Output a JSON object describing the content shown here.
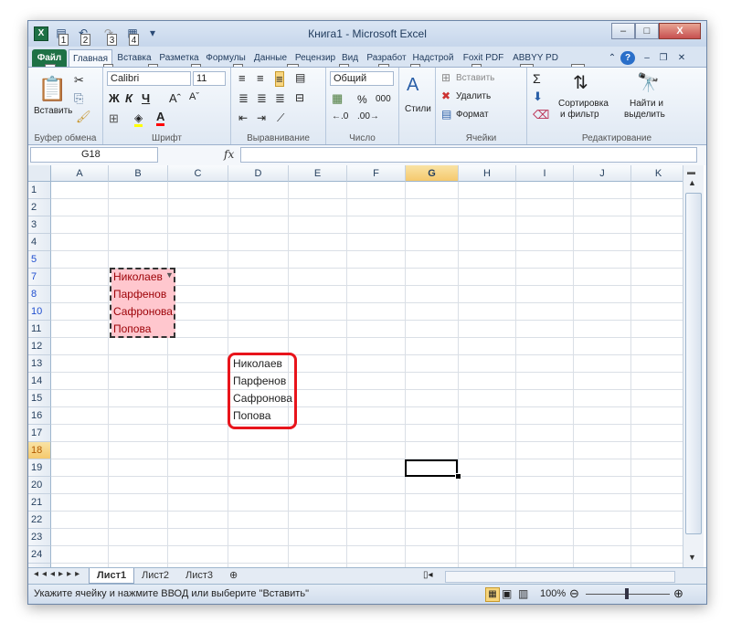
{
  "window": {
    "title": "Книга1 - Microsoft Excel",
    "minimize": "–",
    "maximize": "□",
    "close": "X"
  },
  "qat": {
    "keytips": [
      "1",
      "2",
      "3",
      "4"
    ]
  },
  "tabs": [
    {
      "label": "Файл",
      "keytip": "Ф"
    },
    {
      "label": "Главная",
      "keytip": "Я"
    },
    {
      "label": "Вставка",
      "keytip": "С"
    },
    {
      "label": "Разметка",
      "keytip": "З"
    },
    {
      "label": "Формулы",
      "keytip": "Л"
    },
    {
      "label": "Данные",
      "keytip": "Ы"
    },
    {
      "label": "Рецензир",
      "keytip": "Р"
    },
    {
      "label": "Вид",
      "keytip": "О"
    },
    {
      "label": "Разработ",
      "keytip": "Ч"
    },
    {
      "label": "Надстрой",
      "keytip": "Н"
    },
    {
      "label": "Foxit PDF",
      "keytip": "31"
    },
    {
      "label": "ABBYY PD",
      "keytip": "32"
    }
  ],
  "ribbon": {
    "clipboard": {
      "paste": "Вставить",
      "label": "Буфер обмена"
    },
    "font": {
      "name": "Calibri",
      "size": "11",
      "label": "Шрифт"
    },
    "alignment": {
      "label": "Выравнивание"
    },
    "number": {
      "format": "Общий",
      "percent": "%",
      "thousands": "000",
      "label": "Число"
    },
    "styles": {
      "label": "Стили"
    },
    "cells": {
      "insert": "Вставить",
      "delete": "Удалить",
      "format": "Формат",
      "label": "Ячейки"
    },
    "editing": {
      "sort": "Сортировка",
      "sort2": "и фильтр",
      "find": "Найти и",
      "find2": "выделить",
      "label": "Редактирование"
    }
  },
  "formula_bar": {
    "name_box": "G18",
    "fx": "fx",
    "value": ""
  },
  "columns": [
    "A",
    "B",
    "C",
    "D",
    "E",
    "F",
    "G",
    "H",
    "I",
    "J",
    "K"
  ],
  "rows": [
    "1",
    "2",
    "3",
    "4",
    "5",
    "7",
    "8",
    "10",
    "11",
    "12",
    "13",
    "14",
    "15",
    "16",
    "17",
    "18",
    "19",
    "20",
    "21",
    "22",
    "23",
    "24",
    "25"
  ],
  "cells": {
    "b5": "Николаев",
    "b7": "Парфенов",
    "b8": "Сафронова",
    "b10": "Попова",
    "d12": "Николаев",
    "d13": "Парфенов",
    "d14": "Сафронова",
    "d15": "Попова"
  },
  "active_cell": "G18",
  "colors": {
    "pink_fill": "#ffc7ce",
    "pink_text": "#9c0006",
    "highlight_red": "#e8141b",
    "excel_green": "#1e7145"
  },
  "sheets": [
    "Лист1",
    "Лист2",
    "Лист3"
  ],
  "status": {
    "message": "Укажите ячейку и нажмите ВВОД или выберите \"Вставить\"",
    "zoom": "100%"
  }
}
